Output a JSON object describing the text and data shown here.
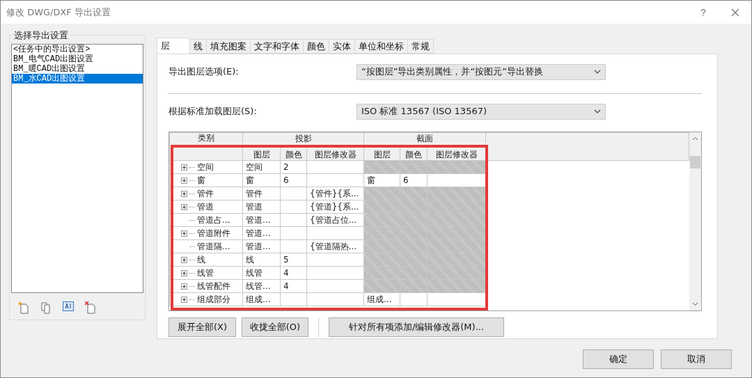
{
  "window": {
    "title": "修改 DWG/DXF 导出设置",
    "help": "?"
  },
  "setups": {
    "title": "选择导出设置",
    "items": [
      {
        "label": "<任务中的导出设置>",
        "selected": false
      },
      {
        "label": "BM_电气CAD出图设置",
        "selected": false
      },
      {
        "label": "BM_暖CAD出图设置",
        "selected": false
      },
      {
        "label": "BM_水CAD出图设置",
        "selected": true
      }
    ]
  },
  "tabs": [
    {
      "label": "层",
      "selected": true
    },
    {
      "label": "线",
      "selected": false
    },
    {
      "label": "填充图案",
      "selected": false
    },
    {
      "label": "文字和字体",
      "selected": false
    },
    {
      "label": "颜色",
      "selected": false
    },
    {
      "label": "实体",
      "selected": false
    },
    {
      "label": "单位和坐标",
      "selected": false
    },
    {
      "label": "常规",
      "selected": false
    }
  ],
  "export_layer_options": {
    "label": "导出图层选项(E):",
    "value": "“按图层”导出类别属性，并“按图元”导出替换"
  },
  "load_layers": {
    "label": "根据标准加载图层(S):",
    "value": "ISO 标准 13567 (ISO 13567)"
  },
  "table": {
    "category_header": "类别",
    "groups": [
      "投影",
      "截面"
    ],
    "columns": [
      "图层",
      "颜色",
      "图层修改器",
      "图层",
      "颜色",
      "图层修改器"
    ],
    "rows": [
      {
        "category": "空间",
        "expandable": true,
        "projection": {
          "layer": "空间",
          "color_no": "2"
        },
        "cut_available": false
      },
      {
        "category": "窗",
        "expandable": true,
        "projection": {
          "layer": "窗",
          "color_no": "6"
        },
        "cut_available": true,
        "cut": {
          "layer": "窗",
          "color_no": "6"
        }
      },
      {
        "category": "管件",
        "expandable": true,
        "projection": {
          "layer": "管件",
          "modifier": "{管件}{系..."
        },
        "cut_available": false
      },
      {
        "category": "管道",
        "expandable": true,
        "projection": {
          "layer": "管道",
          "modifier": "{管道}{系..."
        },
        "cut_available": false
      },
      {
        "category": "管道占...",
        "expandable": false,
        "projection": {
          "layer": "管道...",
          "modifier": "{管道占位..."
        },
        "cut_available": false
      },
      {
        "category": "管道附件",
        "expandable": true,
        "projection": {
          "layer": "管道..."
        },
        "cut_available": false
      },
      {
        "category": "管道隔...",
        "expandable": false,
        "projection": {
          "layer": "管道...",
          "modifier": "{管道隔热..."
        },
        "cut_available": false
      },
      {
        "category": "线",
        "expandable": true,
        "projection": {
          "layer": "线",
          "color_no": "5"
        },
        "cut_available": false
      },
      {
        "category": "线管",
        "expandable": true,
        "projection": {
          "layer": "线管",
          "color_no": "4"
        },
        "cut_available": false
      },
      {
        "category": "线管配件",
        "expandable": true,
        "projection": {
          "layer": "线管...",
          "color_no": "4"
        },
        "cut_available": false
      },
      {
        "category": "组成部分",
        "expandable": true,
        "projection": {
          "layer": "组成..."
        },
        "cut_available": true,
        "cut": {
          "layer": "组成..."
        }
      }
    ]
  },
  "table_buttons": [
    "展开全部(X)",
    "收拢全部(O)",
    "针对所有项添加/编辑修改器(M)..."
  ],
  "dialog_buttons": [
    "确定",
    "取消"
  ]
}
